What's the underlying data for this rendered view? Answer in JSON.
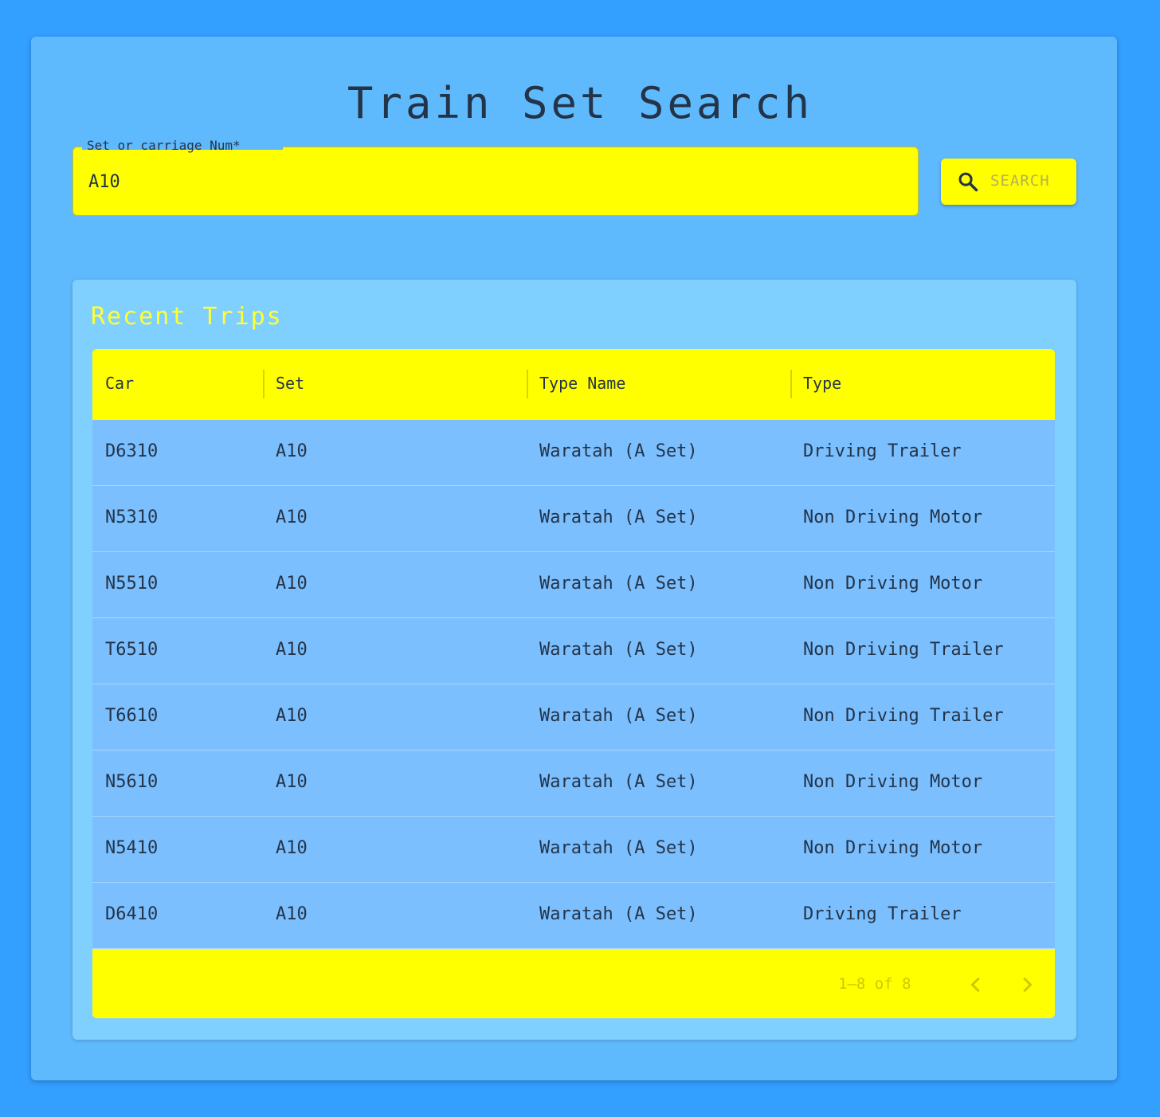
{
  "page": {
    "title": "Train Set Search"
  },
  "search": {
    "label": "Set or carriage Num",
    "required_marker": "*",
    "value": "A10",
    "button_label": "SEARCH"
  },
  "recent_trips": {
    "title": "Recent Trips",
    "columns": [
      "Car",
      "Set",
      "Type Name",
      "Type"
    ],
    "rows": [
      {
        "car": "D6310",
        "set": "A10",
        "type_name": "Waratah (A Set)",
        "type": "Driving Trailer"
      },
      {
        "car": "N5310",
        "set": "A10",
        "type_name": "Waratah (A Set)",
        "type": "Non Driving Motor"
      },
      {
        "car": "N5510",
        "set": "A10",
        "type_name": "Waratah (A Set)",
        "type": "Non Driving Motor"
      },
      {
        "car": "T6510",
        "set": "A10",
        "type_name": "Waratah (A Set)",
        "type": "Non Driving Trailer"
      },
      {
        "car": "T6610",
        "set": "A10",
        "type_name": "Waratah (A Set)",
        "type": "Non Driving Trailer"
      },
      {
        "car": "N5610",
        "set": "A10",
        "type_name": "Waratah (A Set)",
        "type": "Non Driving Motor"
      },
      {
        "car": "N5410",
        "set": "A10",
        "type_name": "Waratah (A Set)",
        "type": "Non Driving Motor"
      },
      {
        "car": "D6410",
        "set": "A10",
        "type_name": "Waratah (A Set)",
        "type": "Driving Trailer"
      }
    ],
    "pagination": {
      "label": "1–8 of 8"
    }
  },
  "colors": {
    "background": "#339fff",
    "card": "#5fb9fd",
    "panel": "#80d0ff",
    "accent": "#ffff00",
    "row": "#7bbfff",
    "text": "#243448"
  },
  "icons": {
    "search": "search-icon",
    "prev": "chevron-left-icon",
    "next": "chevron-right-icon"
  }
}
